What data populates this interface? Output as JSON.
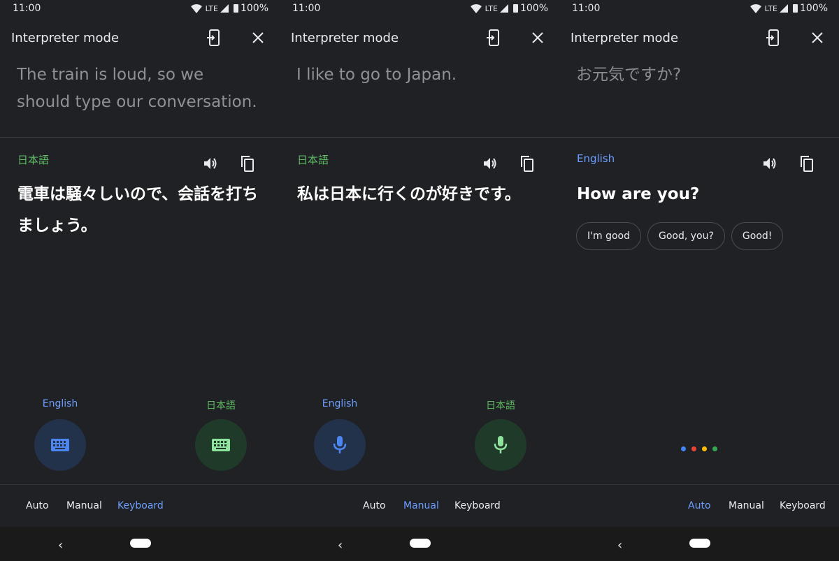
{
  "status_bar": {
    "time": "11:00",
    "network": "LTE",
    "battery": "100%"
  },
  "title": "Interpreter mode",
  "source_lang": "English",
  "target_lang": "日本語",
  "modes": [
    "Auto",
    "Manual",
    "Keyboard"
  ],
  "colors": {
    "english": "#6d9eff",
    "japanese": "#5dbb63",
    "active_mode": "#6d9eff"
  },
  "screens": [
    {
      "source_text": "The train is loud, so we should type our conversation.",
      "translation_language": "日本語",
      "translation_text": "電車は騒々しいので、会話を打ちましょう。",
      "input_icon": "keyboard-icon",
      "active_mode": "Keyboard"
    },
    {
      "source_text": "I like to go to Japan.",
      "translation_language": "日本語",
      "translation_text": "私は日本に行くのが好きです。",
      "input_icon": "microphone-icon",
      "active_mode": "Manual"
    },
    {
      "source_text": "お元気ですか?",
      "translation_language": "English",
      "translation_text": "How are you?",
      "suggestions": [
        "I'm good",
        "Good, you?",
        "Good!"
      ],
      "listening_indicator_colors": [
        "#4285f4",
        "#ea4335",
        "#fbbc04",
        "#34a853"
      ],
      "active_mode": "Auto"
    }
  ]
}
